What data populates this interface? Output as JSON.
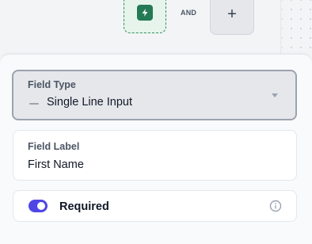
{
  "canvas": {
    "and_label": "AND",
    "add_label": "+",
    "trigger_icon": "lightning-bolt-icon",
    "trigger_color": "#237a55"
  },
  "panel": {
    "field_type": {
      "label": "Field Type",
      "value": "Single Line Input",
      "type_icon": "dash-icon",
      "caret_icon": "chevron-down-icon"
    },
    "field_label": {
      "label": "Field Label",
      "value": "First Name"
    },
    "required": {
      "label": "Required",
      "checked": true,
      "toggle_color": "#4f46e5",
      "info_icon": "info-icon"
    }
  }
}
